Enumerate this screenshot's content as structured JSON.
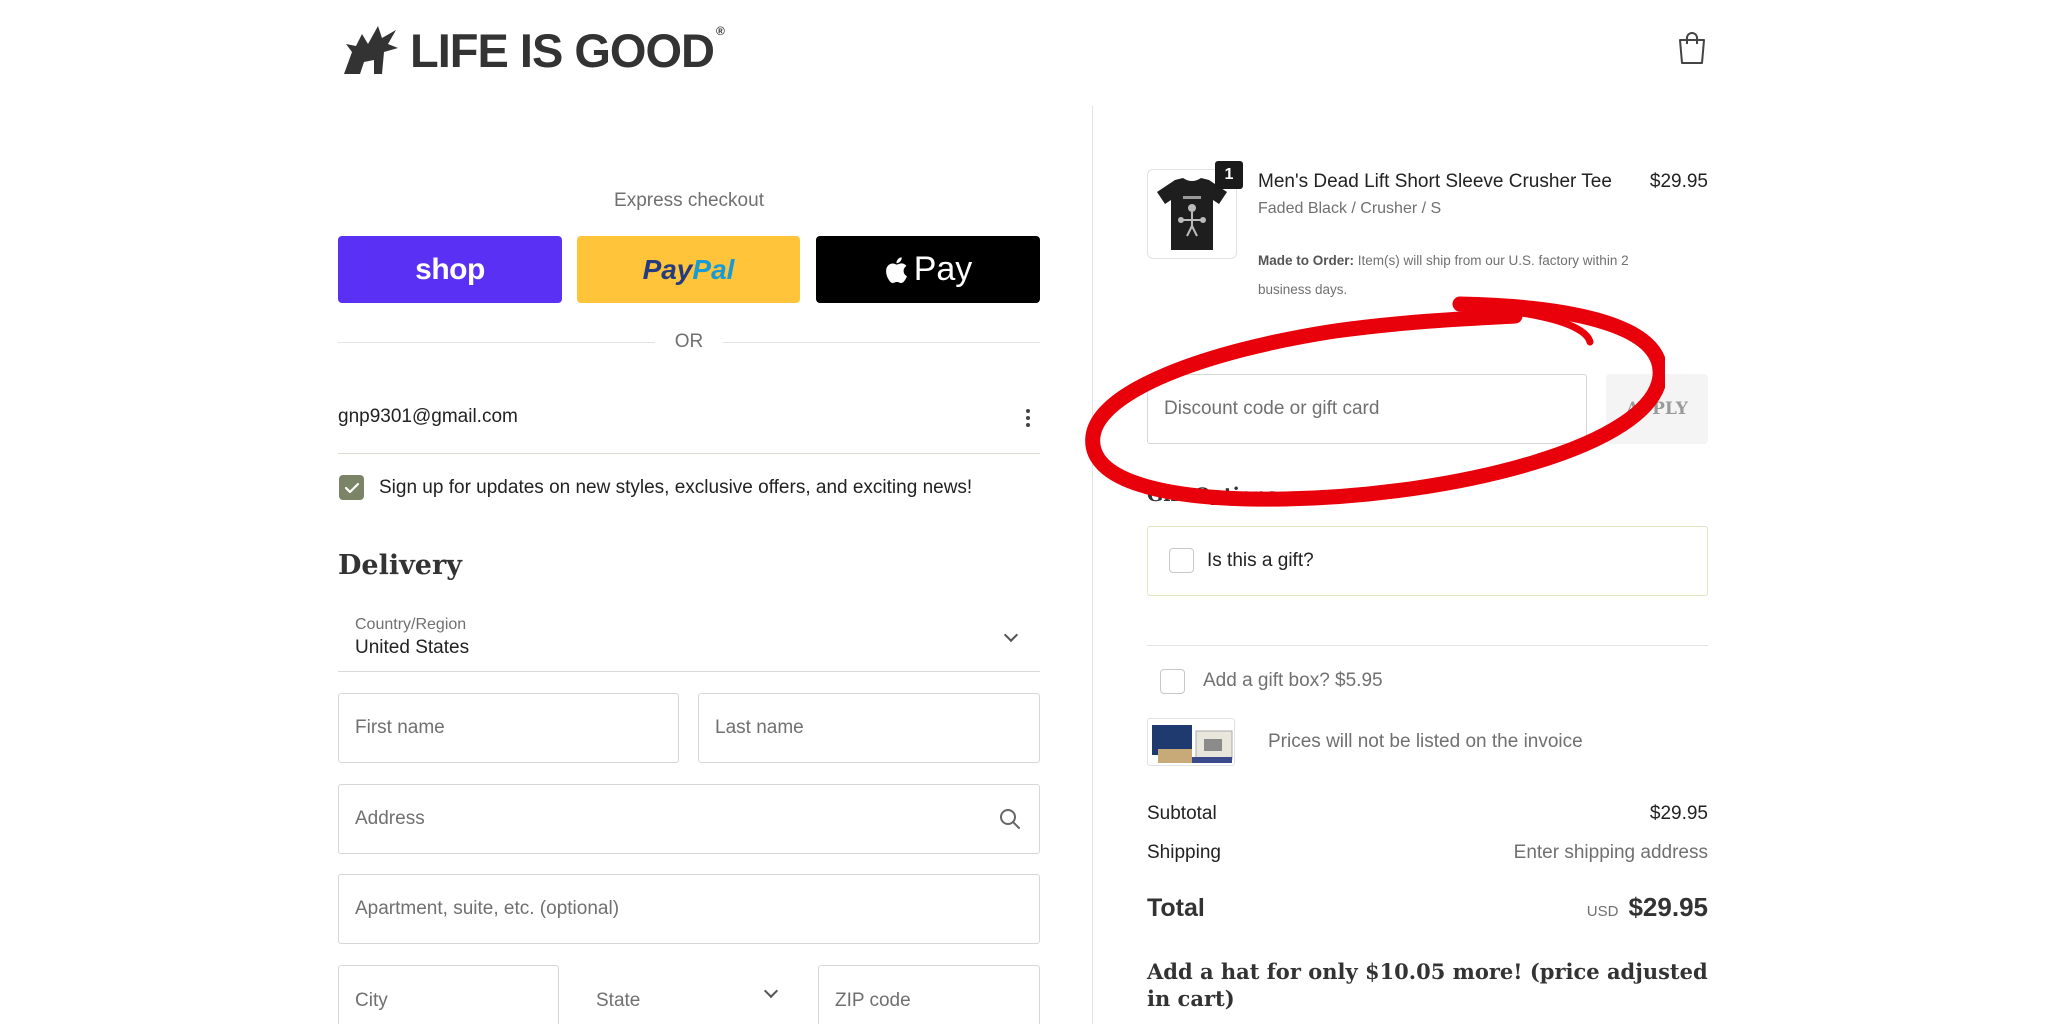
{
  "header": {
    "logo_text": "LIFE IS GOOD",
    "logo_mark": "®"
  },
  "express": {
    "label": "Express checkout",
    "shop_label": "shop",
    "paypal_part1": "Pay",
    "paypal_part2": "Pal",
    "apple_label": "Pay"
  },
  "separator": {
    "or": "OR"
  },
  "contact": {
    "email": "gnp9301@gmail.com",
    "newsletter_label": "Sign up for updates on new styles, exclusive offers, and exciting news!",
    "newsletter_checked": true
  },
  "delivery": {
    "heading": "Delivery",
    "country_label": "Country/Region",
    "country_value": "United States",
    "first_name_placeholder": "First name",
    "last_name_placeholder": "Last name",
    "address_placeholder": "Address",
    "apartment_placeholder": "Apartment, suite, etc. (optional)",
    "city_placeholder": "City",
    "state_placeholder": "State",
    "zip_placeholder": "ZIP code"
  },
  "cart": {
    "item": {
      "quantity": "1",
      "name": "Men's Dead Lift Short Sleeve Crusher Tee",
      "variant": "Faded Black / Crusher / S",
      "price": "$29.95",
      "note_bold": "Made to Order:",
      "note_text": " Item(s) will ship from our U.S. factory within 2 business days."
    }
  },
  "discount": {
    "placeholder": "Discount code or gift card",
    "apply_label": "APPLY"
  },
  "gift": {
    "heading": "Gift Options",
    "is_gift_label": "Is this a gift?",
    "gift_box_label": "Add a gift box? $5.95",
    "invoice_note": "Prices will not be listed on the invoice"
  },
  "summary": {
    "subtotal_label": "Subtotal",
    "subtotal_value": "$29.95",
    "shipping_label": "Shipping",
    "shipping_value": "Enter shipping address",
    "total_label": "Total",
    "currency": "USD",
    "total_value": "$29.95"
  },
  "upsell": {
    "text": "Add a hat for only $10.05 more! (price adjusted in cart)"
  },
  "colors": {
    "shop_pay": "#5a31f4",
    "paypal": "#ffc439",
    "apple_pay": "#000000",
    "checkbox_checked": "#7b8466",
    "annotation": "#e8000b"
  },
  "icons": [
    "logo-dragon-icon",
    "shopping-bag-icon",
    "apple-logo-icon",
    "more-vertical-icon",
    "checkmark-icon",
    "chevron-down-icon",
    "search-icon"
  ]
}
